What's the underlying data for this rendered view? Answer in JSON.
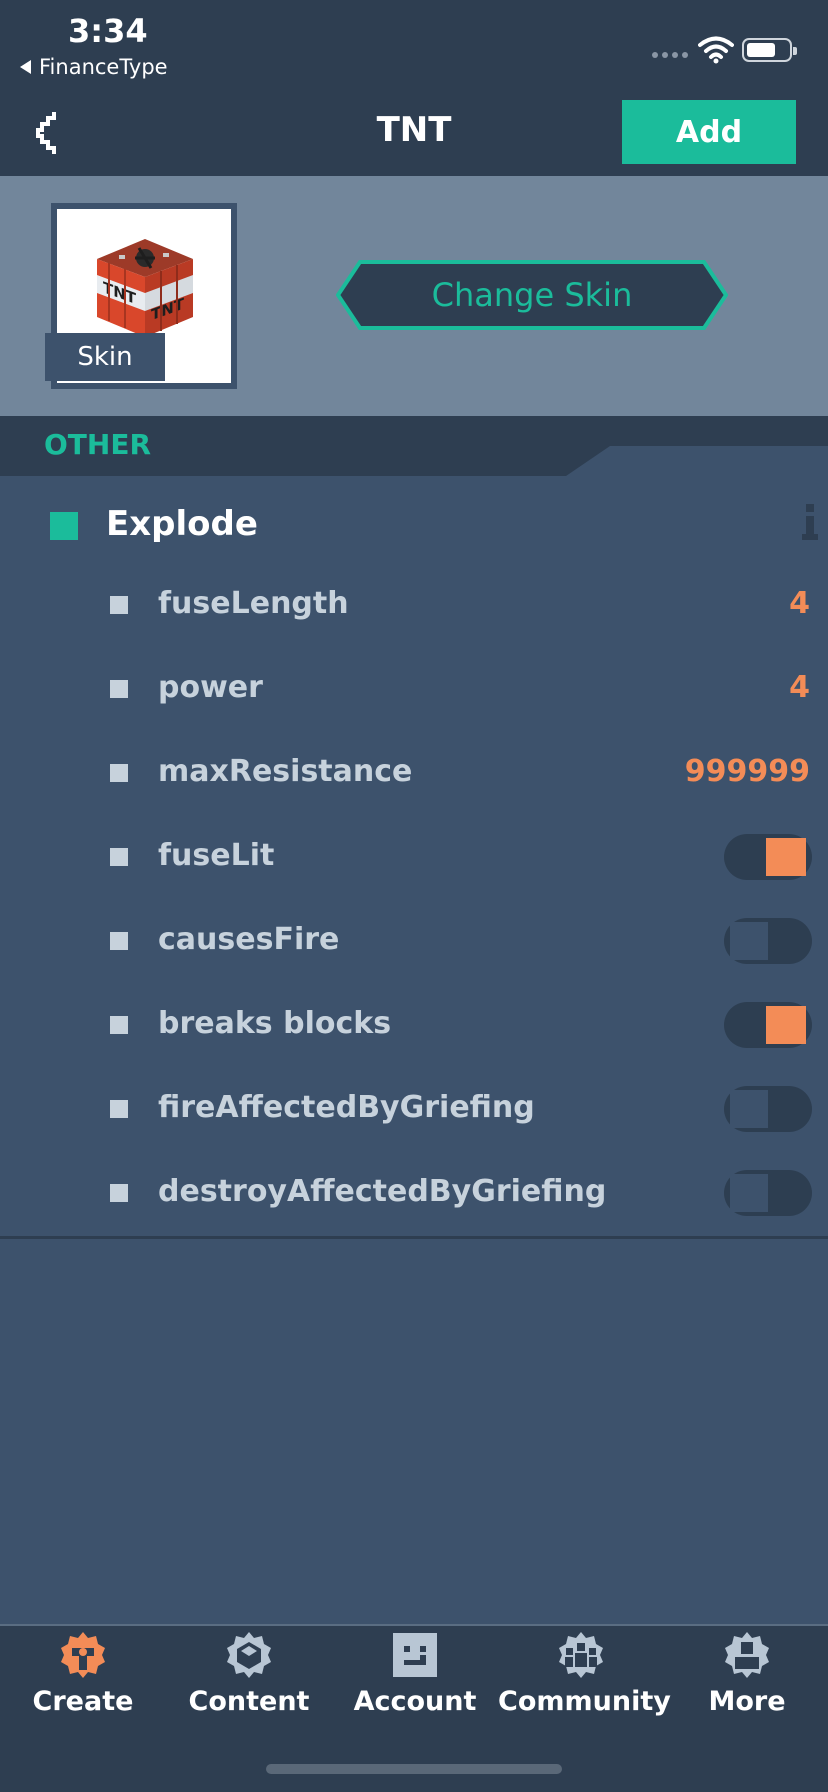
{
  "status": {
    "time": "3:34",
    "back_app": "FinanceType"
  },
  "nav": {
    "title": "TNT",
    "add_label": "Add"
  },
  "skin": {
    "label": "Skin",
    "change_label": "Change Skin"
  },
  "section": {
    "title": "OTHER"
  },
  "group": {
    "label": "Explode",
    "properties": [
      {
        "label": "fuseLength",
        "value": "4"
      },
      {
        "label": "power",
        "value": "4"
      },
      {
        "label": "maxResistance",
        "value": "999999"
      },
      {
        "label": "fuseLit",
        "toggle": true
      },
      {
        "label": "causesFire",
        "toggle": false
      },
      {
        "label": "breaks blocks",
        "toggle": true
      },
      {
        "label": "fireAffectedByGriefing",
        "toggle": false
      },
      {
        "label": "destroyAffectedByGriefing",
        "toggle": false
      }
    ]
  },
  "tabs": [
    {
      "label": "Create",
      "icon": "create-icon",
      "active": true
    },
    {
      "label": "Content",
      "icon": "content-icon"
    },
    {
      "label": "Account",
      "icon": "account-icon"
    },
    {
      "label": "Community",
      "icon": "community-icon"
    },
    {
      "label": "More",
      "icon": "more-icon"
    }
  ],
  "colors": {
    "accent": "#1bbc9b",
    "value": "#f38c57",
    "tab_active": "#f38c57",
    "tab_icon": "#b8c6d4"
  }
}
